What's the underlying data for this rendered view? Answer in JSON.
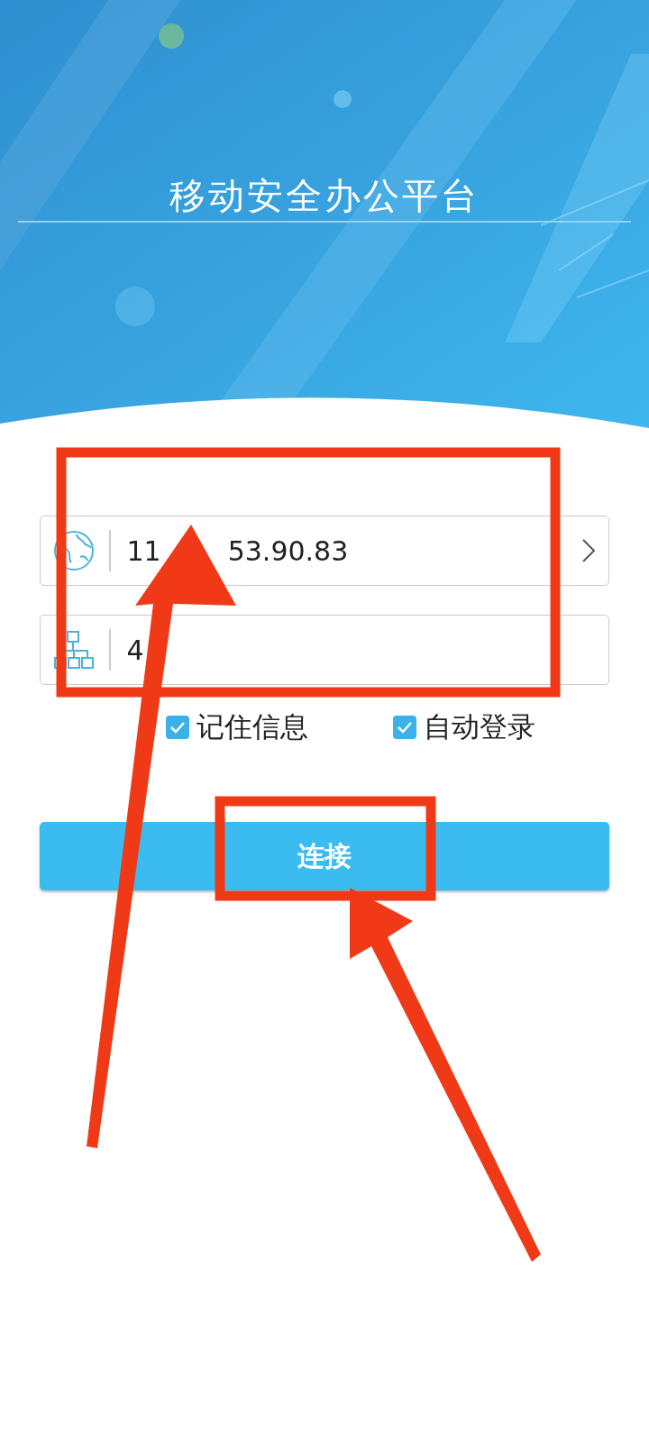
{
  "header": {
    "title": "移动安全办公平台"
  },
  "fields": [
    {
      "kind": "server",
      "value_parts": [
        "11",
        "53.90.83"
      ],
      "has_chevron": true
    },
    {
      "kind": "port",
      "value_parts": [
        "4"
      ],
      "has_chevron": false
    }
  ],
  "options": [
    {
      "label": "记住信息",
      "checked": true
    },
    {
      "label": "自动登录",
      "checked": true
    }
  ],
  "connect_button": "连接"
}
